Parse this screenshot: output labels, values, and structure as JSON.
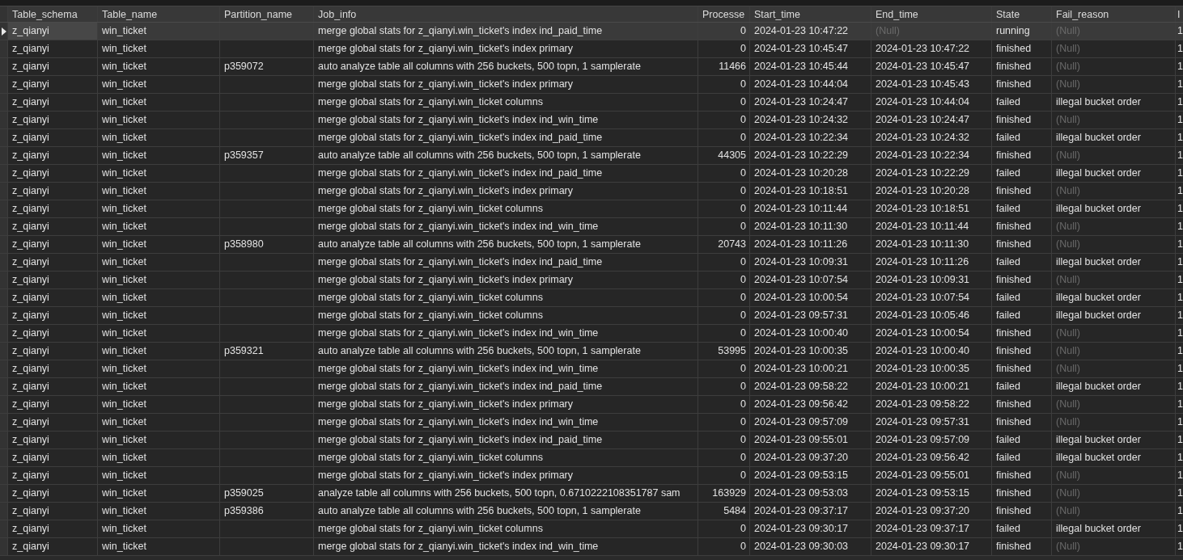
{
  "table": {
    "columns": [
      "Table_schema",
      "Table_name",
      "Partition_name",
      "Job_info",
      "Processe",
      "Start_time",
      "End_time",
      "State",
      "Fail_reason",
      "I"
    ],
    "rows": [
      {
        "selected": true,
        "cells": [
          "z_qianyi",
          "win_ticket",
          "",
          "merge global stats for z_qianyi.win_ticket's index ind_paid_time",
          "0",
          "2024-01-23 10:47:22",
          {
            "text": "(Null)",
            "dimmed": true
          },
          "running",
          {
            "text": "(Null)",
            "dimmed": true
          },
          "1"
        ]
      },
      {
        "selected": false,
        "cells": [
          "z_qianyi",
          "win_ticket",
          "",
          "merge global stats for z_qianyi.win_ticket's index primary",
          "0",
          "2024-01-23 10:45:47",
          "2024-01-23 10:47:22",
          "finished",
          {
            "text": "(Null)",
            "dimmed": true
          },
          "1"
        ]
      },
      {
        "selected": false,
        "cells": [
          "z_qianyi",
          "win_ticket",
          "p359072",
          "auto analyze table all columns with 256 buckets, 500 topn, 1 samplerate",
          "11466",
          "2024-01-23 10:45:44",
          "2024-01-23 10:45:47",
          "finished",
          {
            "text": "(Null)",
            "dimmed": true
          },
          "1"
        ]
      },
      {
        "selected": false,
        "cells": [
          "z_qianyi",
          "win_ticket",
          "",
          "merge global stats for z_qianyi.win_ticket's index primary",
          "0",
          "2024-01-23 10:44:04",
          "2024-01-23 10:45:43",
          "finished",
          {
            "text": "(Null)",
            "dimmed": true
          },
          "1"
        ]
      },
      {
        "selected": false,
        "cells": [
          "z_qianyi",
          "win_ticket",
          "",
          "merge global stats for z_qianyi.win_ticket columns",
          "0",
          "2024-01-23 10:24:47",
          "2024-01-23 10:44:04",
          "failed",
          "illegal bucket order",
          "1"
        ]
      },
      {
        "selected": false,
        "cells": [
          "z_qianyi",
          "win_ticket",
          "",
          "merge global stats for z_qianyi.win_ticket's index ind_win_time",
          "0",
          "2024-01-23 10:24:32",
          "2024-01-23 10:24:47",
          "finished",
          {
            "text": "(Null)",
            "dimmed": true
          },
          "1"
        ]
      },
      {
        "selected": false,
        "cells": [
          "z_qianyi",
          "win_ticket",
          "",
          "merge global stats for z_qianyi.win_ticket's index ind_paid_time",
          "0",
          "2024-01-23 10:22:34",
          "2024-01-23 10:24:32",
          "failed",
          "illegal bucket order",
          "1"
        ]
      },
      {
        "selected": false,
        "cells": [
          "z_qianyi",
          "win_ticket",
          "p359357",
          "auto analyze table all columns with 256 buckets, 500 topn, 1 samplerate",
          "44305",
          "2024-01-23 10:22:29",
          "2024-01-23 10:22:34",
          "finished",
          {
            "text": "(Null)",
            "dimmed": true
          },
          "1"
        ]
      },
      {
        "selected": false,
        "cells": [
          "z_qianyi",
          "win_ticket",
          "",
          "merge global stats for z_qianyi.win_ticket's index ind_paid_time",
          "0",
          "2024-01-23 10:20:28",
          "2024-01-23 10:22:29",
          "failed",
          "illegal bucket order",
          "1"
        ]
      },
      {
        "selected": false,
        "cells": [
          "z_qianyi",
          "win_ticket",
          "",
          "merge global stats for z_qianyi.win_ticket's index primary",
          "0",
          "2024-01-23 10:18:51",
          "2024-01-23 10:20:28",
          "finished",
          {
            "text": "(Null)",
            "dimmed": true
          },
          "1"
        ]
      },
      {
        "selected": false,
        "cells": [
          "z_qianyi",
          "win_ticket",
          "",
          "merge global stats for z_qianyi.win_ticket columns",
          "0",
          "2024-01-23 10:11:44",
          "2024-01-23 10:18:51",
          "failed",
          "illegal bucket order",
          "1"
        ]
      },
      {
        "selected": false,
        "cells": [
          "z_qianyi",
          "win_ticket",
          "",
          "merge global stats for z_qianyi.win_ticket's index ind_win_time",
          "0",
          "2024-01-23 10:11:30",
          "2024-01-23 10:11:44",
          "finished",
          {
            "text": "(Null)",
            "dimmed": true
          },
          "1"
        ]
      },
      {
        "selected": false,
        "cells": [
          "z_qianyi",
          "win_ticket",
          "p358980",
          "auto analyze table all columns with 256 buckets, 500 topn, 1 samplerate",
          "20743",
          "2024-01-23 10:11:26",
          "2024-01-23 10:11:30",
          "finished",
          {
            "text": "(Null)",
            "dimmed": true
          },
          "1"
        ]
      },
      {
        "selected": false,
        "cells": [
          "z_qianyi",
          "win_ticket",
          "",
          "merge global stats for z_qianyi.win_ticket's index ind_paid_time",
          "0",
          "2024-01-23 10:09:31",
          "2024-01-23 10:11:26",
          "failed",
          "illegal bucket order",
          "1"
        ]
      },
      {
        "selected": false,
        "cells": [
          "z_qianyi",
          "win_ticket",
          "",
          "merge global stats for z_qianyi.win_ticket's index primary",
          "0",
          "2024-01-23 10:07:54",
          "2024-01-23 10:09:31",
          "finished",
          {
            "text": "(Null)",
            "dimmed": true
          },
          "1"
        ]
      },
      {
        "selected": false,
        "cells": [
          "z_qianyi",
          "win_ticket",
          "",
          "merge global stats for z_qianyi.win_ticket columns",
          "0",
          "2024-01-23 10:00:54",
          "2024-01-23 10:07:54",
          "failed",
          "illegal bucket order",
          "1"
        ]
      },
      {
        "selected": false,
        "cells": [
          "z_qianyi",
          "win_ticket",
          "",
          "merge global stats for z_qianyi.win_ticket columns",
          "0",
          "2024-01-23 09:57:31",
          "2024-01-23 10:05:46",
          "failed",
          "illegal bucket order",
          "1"
        ]
      },
      {
        "selected": false,
        "cells": [
          "z_qianyi",
          "win_ticket",
          "",
          "merge global stats for z_qianyi.win_ticket's index ind_win_time",
          "0",
          "2024-01-23 10:00:40",
          "2024-01-23 10:00:54",
          "finished",
          {
            "text": "(Null)",
            "dimmed": true
          },
          "1"
        ]
      },
      {
        "selected": false,
        "cells": [
          "z_qianyi",
          "win_ticket",
          "p359321",
          "auto analyze table all columns with 256 buckets, 500 topn, 1 samplerate",
          "53995",
          "2024-01-23 10:00:35",
          "2024-01-23 10:00:40",
          "finished",
          {
            "text": "(Null)",
            "dimmed": true
          },
          "1"
        ]
      },
      {
        "selected": false,
        "cells": [
          "z_qianyi",
          "win_ticket",
          "",
          "merge global stats for z_qianyi.win_ticket's index ind_win_time",
          "0",
          "2024-01-23 10:00:21",
          "2024-01-23 10:00:35",
          "finished",
          {
            "text": "(Null)",
            "dimmed": true
          },
          "1"
        ]
      },
      {
        "selected": false,
        "cells": [
          "z_qianyi",
          "win_ticket",
          "",
          "merge global stats for z_qianyi.win_ticket's index ind_paid_time",
          "0",
          "2024-01-23 09:58:22",
          "2024-01-23 10:00:21",
          "failed",
          "illegal bucket order",
          "1"
        ]
      },
      {
        "selected": false,
        "cells": [
          "z_qianyi",
          "win_ticket",
          "",
          "merge global stats for z_qianyi.win_ticket's index primary",
          "0",
          "2024-01-23 09:56:42",
          "2024-01-23 09:58:22",
          "finished",
          {
            "text": "(Null)",
            "dimmed": true
          },
          "1"
        ]
      },
      {
        "selected": false,
        "cells": [
          "z_qianyi",
          "win_ticket",
          "",
          "merge global stats for z_qianyi.win_ticket's index ind_win_time",
          "0",
          "2024-01-23 09:57:09",
          "2024-01-23 09:57:31",
          "finished",
          {
            "text": "(Null)",
            "dimmed": true
          },
          "1"
        ]
      },
      {
        "selected": false,
        "cells": [
          "z_qianyi",
          "win_ticket",
          "",
          "merge global stats for z_qianyi.win_ticket's index ind_paid_time",
          "0",
          "2024-01-23 09:55:01",
          "2024-01-23 09:57:09",
          "failed",
          "illegal bucket order",
          "1"
        ]
      },
      {
        "selected": false,
        "cells": [
          "z_qianyi",
          "win_ticket",
          "",
          "merge global stats for z_qianyi.win_ticket columns",
          "0",
          "2024-01-23 09:37:20",
          "2024-01-23 09:56:42",
          "failed",
          "illegal bucket order",
          "1"
        ]
      },
      {
        "selected": false,
        "cells": [
          "z_qianyi",
          "win_ticket",
          "",
          "merge global stats for z_qianyi.win_ticket's index primary",
          "0",
          "2024-01-23 09:53:15",
          "2024-01-23 09:55:01",
          "finished",
          {
            "text": "(Null)",
            "dimmed": true
          },
          "1"
        ]
      },
      {
        "selected": false,
        "cells": [
          "z_qianyi",
          "win_ticket",
          "p359025",
          "analyze table all columns with 256 buckets, 500 topn, 0.6710222108351787 sam",
          "163929",
          "2024-01-23 09:53:03",
          "2024-01-23 09:53:15",
          "finished",
          {
            "text": "(Null)",
            "dimmed": true
          },
          "1"
        ]
      },
      {
        "selected": false,
        "cells": [
          "z_qianyi",
          "win_ticket",
          "p359386",
          "auto analyze table all columns with 256 buckets, 500 topn, 1 samplerate",
          "5484",
          "2024-01-23 09:37:17",
          "2024-01-23 09:37:20",
          "finished",
          {
            "text": "(Null)",
            "dimmed": true
          },
          "1"
        ]
      },
      {
        "selected": false,
        "cells": [
          "z_qianyi",
          "win_ticket",
          "",
          "merge global stats for z_qianyi.win_ticket columns",
          "0",
          "2024-01-23 09:30:17",
          "2024-01-23 09:37:17",
          "failed",
          "illegal bucket order",
          "1"
        ]
      },
      {
        "selected": false,
        "cells": [
          "z_qianyi",
          "win_ticket",
          "",
          "merge global stats for z_qianyi.win_ticket's index ind_win_time",
          "0",
          "2024-01-23 09:30:03",
          "2024-01-23 09:30:17",
          "finished",
          {
            "text": "(Null)",
            "dimmed": true
          },
          "1"
        ]
      }
    ]
  }
}
